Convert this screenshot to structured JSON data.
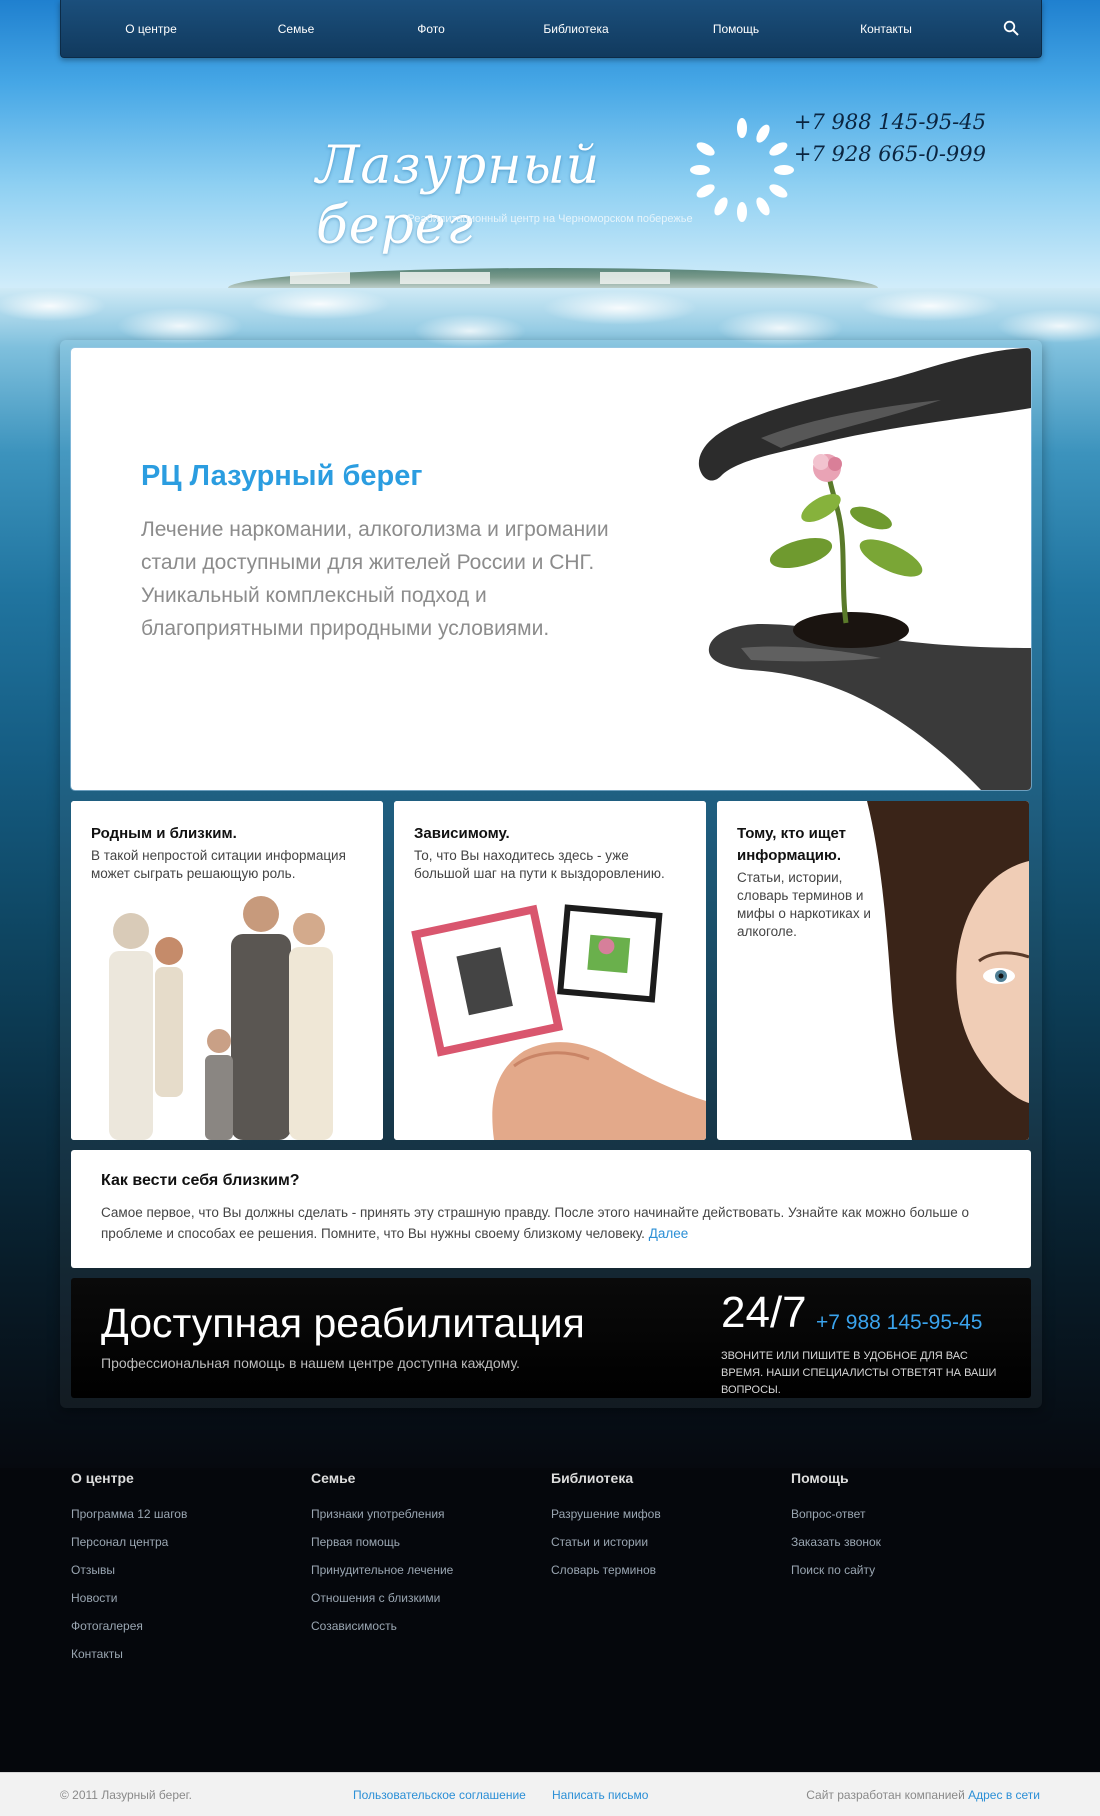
{
  "nav": {
    "items": [
      "О центре",
      "Семье",
      "Фото",
      "Библиотека",
      "Помощь",
      "Контакты"
    ],
    "search_icon": "search-icon"
  },
  "header": {
    "logo": "Лазурный берег",
    "tagline": "Реабилитационный центр на Черноморском побережье",
    "phones": [
      "+7 988 145-95-45",
      "+7 928 665-0-999"
    ]
  },
  "hero": {
    "title": "РЦ Лазурный берег",
    "text": "Лечение наркомании, алкоголизма и игромании стали доступными для жителей России и СНГ. Уникальный комплексный подход и благоприятными природными условиями."
  },
  "cards": [
    {
      "title": "Родным и близким.",
      "text": "В такой непростой ситации информация может сыграть решающую роль."
    },
    {
      "title": "Зависимому.",
      "text": "То, что Вы находитесь здесь - уже большой шаг на пути к выздоровлению."
    },
    {
      "title": "Тому, кто ищет информацию.",
      "text": "Статьи, истории, словарь терминов и мифы о наркотиках и алкоголе."
    }
  ],
  "info": {
    "title": "Как вести себя близким?",
    "text": "Самое первое, что Вы должны сделать - принять эту страшную правду. После этого начинайте действовать. Узнайте как можно больше о проблеме и способах ее решения. Помните, что Вы нужны своему близкому человеку.",
    "more": "Далее"
  },
  "promo": {
    "title": "Доступная реабилитация",
    "subtitle": "Профессиональная помощь в нашем центре доступна каждому.",
    "hours": "24/7",
    "phone": "+7 988 145-95-45",
    "note": "ЗВОНИТЕ ИЛИ ПИШИТЕ В УДОБНОЕ ДЛЯ ВАС ВРЕМЯ. НАШИ СПЕЦИАЛИСТЫ ОТВЕТЯТ НА ВАШИ ВОПРОСЫ."
  },
  "footer": {
    "columns": [
      {
        "title": "О центре",
        "links": [
          "Программа 12 шагов",
          "Персонал центра",
          "Отзывы",
          "Новости",
          "Фотогалерея",
          "Контакты"
        ]
      },
      {
        "title": "Семье",
        "links": [
          "Признаки употребления",
          "Первая помощь",
          "Принудительное лечение",
          "Отношения с близкими",
          "Созависимость"
        ]
      },
      {
        "title": "Библиотека",
        "links": [
          "Разрушение мифов",
          "Статьи и истории",
          "Словарь терминов"
        ]
      },
      {
        "title": "Помощь",
        "links": [
          "Вопрос-ответ",
          "Заказать звонок",
          "Поиск по сайту"
        ]
      }
    ],
    "copyright": "© 2011 Лазурный берег.",
    "agreement": "Пользовательское соглашение",
    "write": "Написать письмо",
    "developer_prefix": "Сайт разработан компанией",
    "developer": "Адрес в сети"
  },
  "colors": {
    "accent": "#2b9de0",
    "nav_bg": "#113a5e",
    "promo_bg": "#000000",
    "link": "#2b8fd6"
  }
}
